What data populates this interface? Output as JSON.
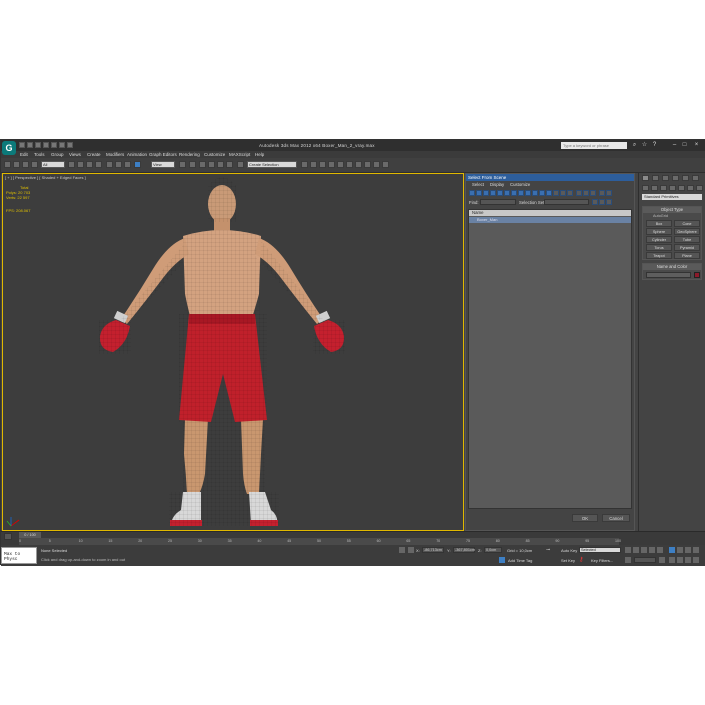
{
  "window": {
    "title": "Autodesk 3ds Max 2012 x64     Boxer_Man_2_vray.max",
    "search_placeholder": "Type a keyword or phrase",
    "logo_letter": "G"
  },
  "menubar": [
    "Edit",
    "Tools",
    "Group",
    "Views",
    "Create",
    "Modifiers",
    "Animation",
    "Graph Editors",
    "Rendering",
    "Customize",
    "MAXScript",
    "Help"
  ],
  "toolbar": {
    "selection_filter": "All",
    "ref_coord": "View",
    "named_selection": "Create Selection"
  },
  "viewport": {
    "label": "[ + ] [ Perspective ] [ Shaded + Edged Faces ]",
    "stats": {
      "total_label": "Total",
      "polys_label": "Polys:",
      "polys": "20 703",
      "verts_label": "Verts:",
      "verts": "22 597",
      "fps_label": "FPS:",
      "fps": "208.067"
    }
  },
  "dialog": {
    "title": "Select From Scene",
    "menu": [
      "Select",
      "Display",
      "Customize"
    ],
    "find_label": "Find:",
    "selection_set_label": "Selection Set:",
    "column_name": "Name",
    "items": [
      "Boxer_Man"
    ],
    "ok_label": "OK",
    "cancel_label": "Cancel"
  },
  "command_panel": {
    "category": "Standard Primitives",
    "object_type_title": "Object Type",
    "autogrid_label": "AutoGrid",
    "objects": [
      "Box",
      "Cone",
      "Sphere",
      "GeoSphere",
      "Cylinder",
      "Tube",
      "Torus",
      "Pyramid",
      "Teapot",
      "Plane"
    ],
    "name_color_title": "Name and Color",
    "object_color": "#8b1a2a"
  },
  "timeline": {
    "frame_counter": "0 / 100",
    "ticks": [
      "0",
      "5",
      "10",
      "15",
      "20",
      "25",
      "30",
      "35",
      "40",
      "45",
      "50",
      "55",
      "60",
      "65",
      "70",
      "75",
      "80",
      "85",
      "90",
      "95",
      "100"
    ]
  },
  "status": {
    "maxscript_text": "Max to Physc",
    "selection_status": "None Selected",
    "prompt": "Click and drag up-and-down to zoom in and out",
    "x_label": "X:",
    "x_value": "-86,713cm",
    "y_label": "Y:",
    "y_value": "-367,801cm",
    "z_label": "Z:",
    "z_value": "0,0cm",
    "grid": "Grid = 10,0cm",
    "auto_key": "Auto Key",
    "selected_dropdown": "Selected",
    "set_key": "Set Key",
    "key_filters": "Key Filters...",
    "add_time_tag": "Add Time Tag"
  },
  "colors": {
    "viewport_border": "#e0b800",
    "stats_text": "#e0c000",
    "dialog_title": "#2d5e9c"
  }
}
